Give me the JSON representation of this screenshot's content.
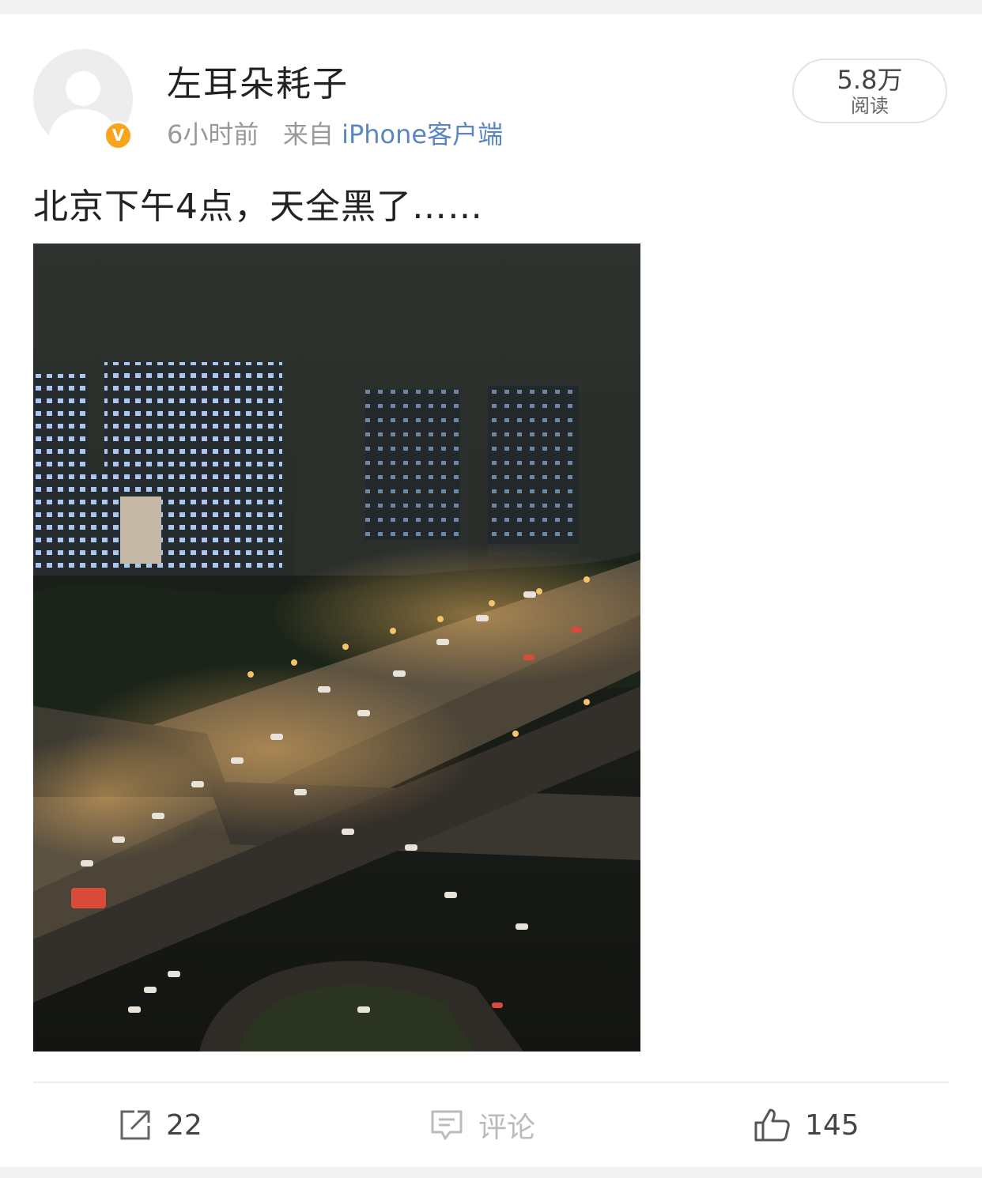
{
  "post": {
    "username": "左耳朵耗子",
    "time": "6小时前",
    "source_prefix": "来自",
    "source": "iPhone客户端",
    "reads": {
      "count": "5.8万",
      "label": "阅读"
    },
    "text": "北京下午4点，天全黑了……",
    "verified_badge": "V"
  },
  "actions": {
    "repost": {
      "icon": "share-icon",
      "label": "22"
    },
    "comment": {
      "icon": "comment-icon",
      "label": "评论"
    },
    "like": {
      "icon": "thumbs-up-icon",
      "label": "145"
    }
  },
  "colors": {
    "link_blue": "#5b86c2",
    "verified_orange": "#f7a51d",
    "muted_gray": "#999999",
    "text_dark": "#222222"
  }
}
